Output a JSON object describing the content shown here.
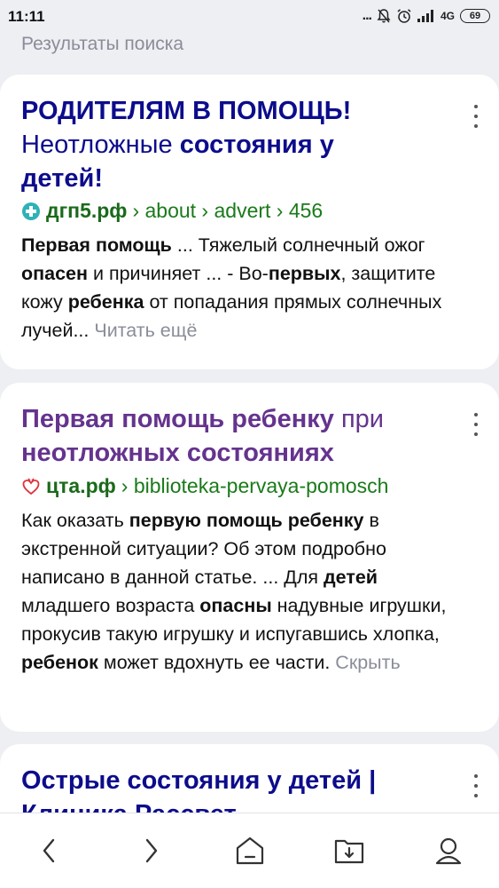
{
  "status_bar": {
    "time": "11:11",
    "dots": "...",
    "network": "4G",
    "battery": "69"
  },
  "section_header": "Результаты поиска",
  "results": [
    {
      "title_line1": "РОДИТЕЛЯМ В ПОМОЩЬ!",
      "title_line2_a": "Неотложные ",
      "title_line2_b": "состояния у",
      "title_line3": "детей!",
      "favicon": "medical-cross-icon",
      "domain": "дгп5.рф",
      "path": "› about › advert › 456",
      "snippet": [
        {
          "b": "Первая помощь"
        },
        {
          "t": " ... Тяжелый солнечный ожог "
        },
        {
          "b": "опасен"
        },
        {
          "t": " и причиняет ... - Во-"
        },
        {
          "b": "первых"
        },
        {
          "t": ", защитите кожу "
        },
        {
          "b": "ребенка"
        },
        {
          "t": " от попадания прямых солнечных лучей... "
        }
      ],
      "more_label": "Читать ещё"
    },
    {
      "title_line1_a": "Первая помощь ребенку ",
      "title_line1_b": "при",
      "title_line2": "неотложных состояниях",
      "favicon": "heart-icon",
      "domain": "цта.рф",
      "path": "› biblioteka-pervaya-pomosch",
      "snippet": [
        {
          "t": "Как оказать "
        },
        {
          "b": "первую помощь ребенку"
        },
        {
          "t": " в экстренной ситуации? Об этом подробно написано в данной статье. ... Для "
        },
        {
          "b": "детей"
        },
        {
          "t": " младшего возраста "
        },
        {
          "b": "опасны"
        },
        {
          "t": " надувные игрушки, прокусив такую игрушку и испугавшись хлопка, "
        },
        {
          "b": "ребенок"
        },
        {
          "t": " может вдохнуть ее части. "
        }
      ],
      "more_label": "Скрыть"
    },
    {
      "title_line1": "Острые состояния у детей |",
      "title_line2": "Клиника Рассвет"
    }
  ],
  "bottom_nav": {
    "back": "back-arrow-icon",
    "forward": "forward-arrow-icon",
    "home": "home-icon",
    "downloads": "downloads-folder-icon",
    "profile": "profile-icon"
  },
  "colors": {
    "title_navy": "#0c0c8c",
    "title_visited": "#65338e",
    "url_green": "#1a7a1a",
    "muted": "#8a8d99",
    "background": "#eeeff3"
  }
}
